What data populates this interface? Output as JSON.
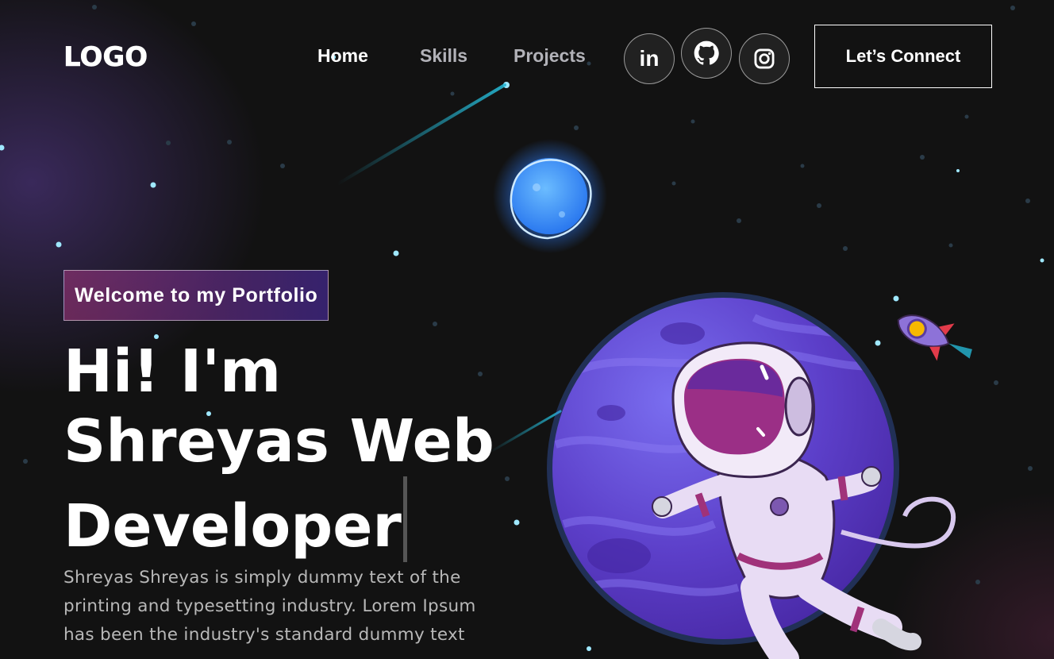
{
  "nav": {
    "logo": "LOGO",
    "links": [
      {
        "label": "Home",
        "active": true
      },
      {
        "label": "Skills",
        "active": false
      },
      {
        "label": "Projects",
        "active": false
      }
    ],
    "social": [
      {
        "name": "linkedin-icon",
        "glyph": "in"
      },
      {
        "name": "github-icon",
        "glyph": ""
      },
      {
        "name": "instagram-icon",
        "glyph": ""
      }
    ],
    "connect_label": "Let’s Connect"
  },
  "hero": {
    "tagline": "Welcome to my Portfolio",
    "line1": "Hi! I'm",
    "line2": "Shreyas Web",
    "line3": "Developer",
    "description": "Shreyas Shreyas is simply dummy text of the printing and typesetting industry. Lorem Ipsum has been the industry's standard dummy text"
  },
  "colors": {
    "background": "#121212",
    "tagline_gradient_start": "#AA367C",
    "tagline_gradient_end": "#4A2FBD",
    "planet": "#6a4bd6"
  }
}
